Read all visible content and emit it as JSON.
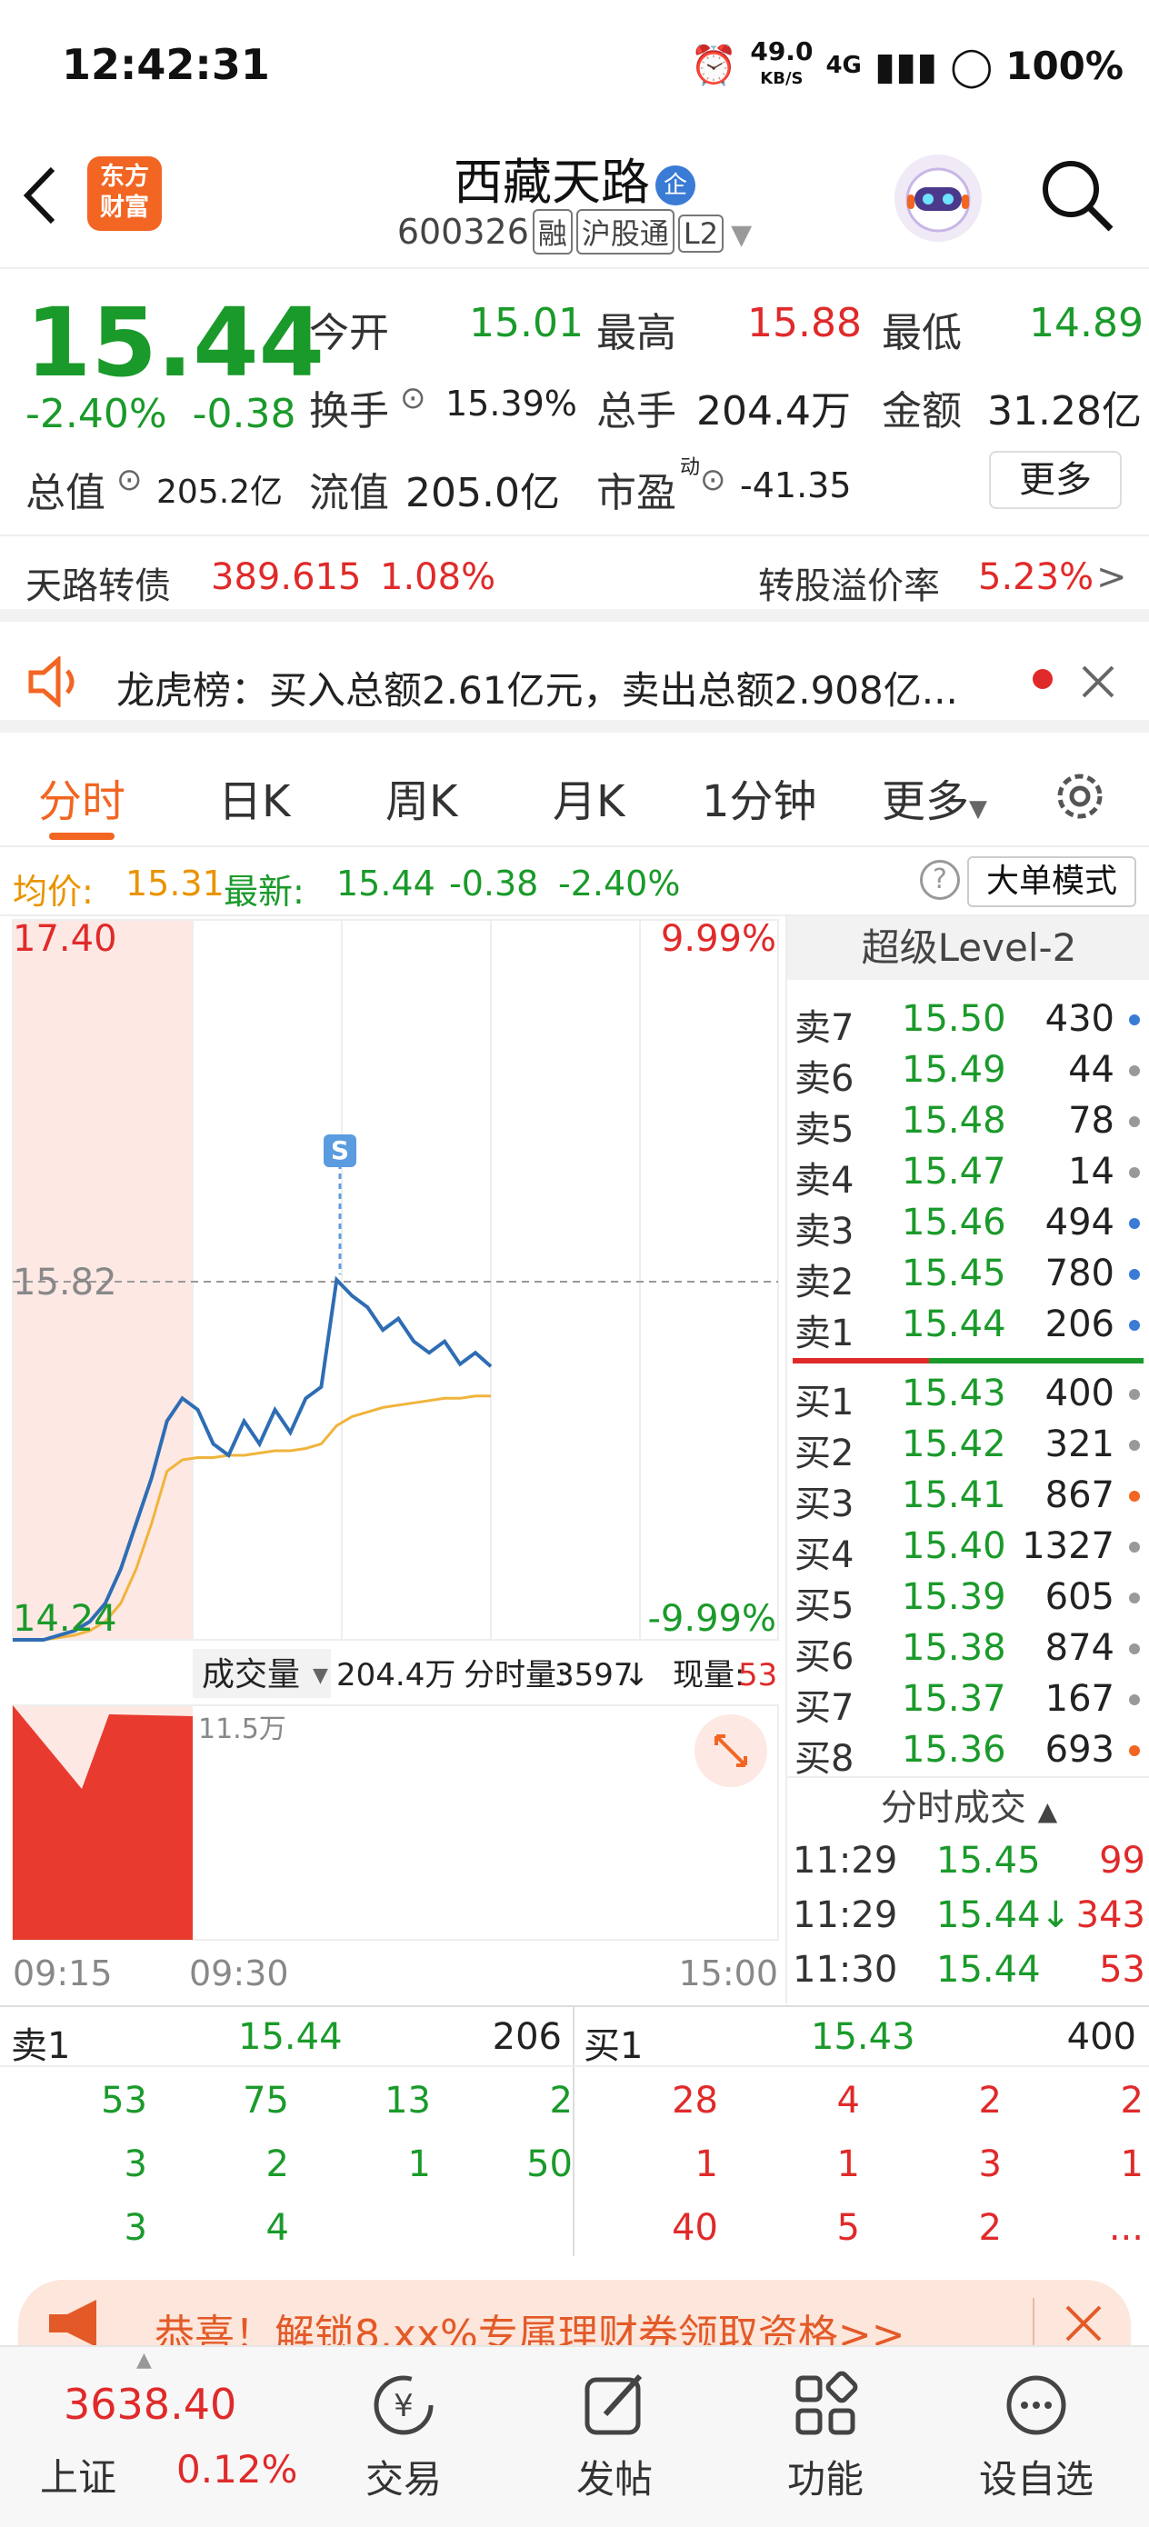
{
  "status_bar": {
    "time": "12:42:31",
    "net_speed": "49.0",
    "net_unit": "KB/S",
    "network": "4G",
    "battery": "100%"
  },
  "header": {
    "stock_name": "西藏天路",
    "badge": "企",
    "code": "600326",
    "tags": [
      "融",
      "沪股通",
      "L2"
    ],
    "logo_line1": "东方",
    "logo_line2": "财富"
  },
  "quote": {
    "price": "15.44",
    "change_pct": "-2.40%",
    "change": "-0.38",
    "open_label": "今开",
    "open": "15.01",
    "high_label": "最高",
    "high": "15.88",
    "low_label": "最低",
    "low": "14.89",
    "turnover_label": "换手",
    "turnover": "15.39%",
    "volume_label": "总手",
    "volume": "204.4万",
    "amount_label": "金额",
    "amount": "31.28亿",
    "mktcap_label": "总值",
    "mktcap": "205.2亿",
    "float_label": "流值",
    "float_cap": "205.0亿",
    "pe_label": "市盈",
    "pe_sup": "动",
    "pe": "-41.35",
    "more_label": "更多"
  },
  "convertible": {
    "name": "天路转债",
    "price": "389.615",
    "pct": "1.08%",
    "premium_label": "转股溢价率",
    "premium": "5.23%"
  },
  "dragon": {
    "text": "龙虎榜：买入总额2.61亿元，卖出总额2.908亿..."
  },
  "tabs": [
    {
      "label": "分时"
    },
    {
      "label": "日K"
    },
    {
      "label": "周K"
    },
    {
      "label": "月K"
    },
    {
      "label": "1分钟"
    },
    {
      "label": "更多"
    }
  ],
  "avg_row": {
    "avg_label": "均价:",
    "avg": "15.31",
    "latest_label": "最新:",
    "latest": "15.44",
    "change": "-0.38",
    "pct": "-2.40%",
    "bigorder_label": "大单模式"
  },
  "chart": {
    "top_price": "17.40",
    "top_pct": "9.99%",
    "mid_price": "15.82",
    "bottom_price": "14.24",
    "bottom_pct": "-9.99%",
    "s_marker": "S",
    "vol_label": "成交量",
    "vol_total": "204.4万",
    "vol_period_label": "分时量:",
    "vol_period": "3597",
    "vol_now_label": "现量:",
    "vol_now": "53",
    "vol_max": "11.5万",
    "t_start": "09:15",
    "t_mid": "09:30",
    "t_end": "15:00"
  },
  "chart_data": {
    "type": "line",
    "title": "",
    "series": [
      {
        "values": [
          14.24,
          14.24,
          14.24,
          14.26,
          14.28,
          14.32,
          14.4,
          14.55,
          14.75,
          14.95,
          15.2,
          15.3,
          15.25,
          15.1,
          15.05,
          15.2,
          15.1,
          15.25,
          15.15,
          15.3,
          15.35,
          15.82,
          15.75,
          15.7,
          15.6,
          15.65,
          15.55,
          15.5,
          15.55,
          15.45,
          15.5,
          15.44
        ]
      },
      {
        "values": [
          14.24,
          14.24,
          14.24,
          14.25,
          14.26,
          14.28,
          14.32,
          14.4,
          14.55,
          14.75,
          14.98,
          15.03,
          15.04,
          15.04,
          15.05,
          15.05,
          15.06,
          15.07,
          15.07,
          15.08,
          15.1,
          15.18,
          15.22,
          15.24,
          15.26,
          15.27,
          15.28,
          15.29,
          15.3,
          15.3,
          15.31,
          15.31
        ]
      }
    ],
    "ylim": [
      14.24,
      17.4
    ]
  },
  "level2": {
    "title": "超级Level-2",
    "asks": [
      {
        "label": "卖7",
        "price": "15.50",
        "vol": "430",
        "dot": "#3a7bd5"
      },
      {
        "label": "卖6",
        "price": "15.49",
        "vol": "44",
        "dot": "#999999"
      },
      {
        "label": "卖5",
        "price": "15.48",
        "vol": "78",
        "dot": "#999999"
      },
      {
        "label": "卖4",
        "price": "15.47",
        "vol": "14",
        "dot": "#999999"
      },
      {
        "label": "卖3",
        "price": "15.46",
        "vol": "494",
        "dot": "#3a7bd5"
      },
      {
        "label": "卖2",
        "price": "15.45",
        "vol": "780",
        "dot": "#3a7bd5"
      },
      {
        "label": "卖1",
        "price": "15.44",
        "vol": "206",
        "dot": "#3a7bd5"
      }
    ],
    "bids": [
      {
        "label": "买1",
        "price": "15.43",
        "vol": "400",
        "dot": "#999999"
      },
      {
        "label": "买2",
        "price": "15.42",
        "vol": "321",
        "dot": "#999999"
      },
      {
        "label": "买3",
        "price": "15.41",
        "vol": "867",
        "dot": "#f26522"
      },
      {
        "label": "买4",
        "price": "15.40",
        "vol": "1327",
        "dot": "#999999"
      },
      {
        "label": "买5",
        "price": "15.39",
        "vol": "605",
        "dot": "#999999"
      },
      {
        "label": "买6",
        "price": "15.38",
        "vol": "874",
        "dot": "#999999"
      },
      {
        "label": "买7",
        "price": "15.37",
        "vol": "167",
        "dot": "#999999"
      },
      {
        "label": "买8",
        "price": "15.36",
        "vol": "693",
        "dot": "#f26522"
      }
    ],
    "trades_title": "分时成交",
    "trades": [
      {
        "time": "11:29",
        "price": "15.45",
        "vol": "99"
      },
      {
        "time": "11:29",
        "price": "15.44↓",
        "vol": "343"
      },
      {
        "time": "11:30",
        "price": "15.44",
        "vol": "53"
      }
    ]
  },
  "queue": {
    "ask": {
      "label": "卖1",
      "price": "15.44",
      "vol": "206",
      "rows": [
        [
          "53",
          "75",
          "13",
          "2"
        ],
        [
          "3",
          "2",
          "1",
          "50"
        ],
        [
          "3",
          "4",
          "",
          ""
        ]
      ]
    },
    "bid": {
      "label": "买1",
      "price": "15.43",
      "vol": "400",
      "rows": [
        [
          "28",
          "4",
          "2",
          "2"
        ],
        [
          "1",
          "1",
          "3",
          "1"
        ],
        [
          "40",
          "5",
          "2",
          "..."
        ]
      ]
    }
  },
  "banner": {
    "text": "恭喜！解锁8.xx%专属理财券领取资格>>"
  },
  "navbar": {
    "index_value": "3638.40",
    "index_name": "上证",
    "index_pct": "0.12%",
    "items": [
      {
        "label": "交易"
      },
      {
        "label": "发帖"
      },
      {
        "label": "功能"
      },
      {
        "label": "设自选"
      }
    ]
  },
  "colors": {
    "up": "#e02a2a",
    "down": "#1a9a2a",
    "accent": "#f26522",
    "price_line": "#2e6db4",
    "avg_line": "#f0b43c"
  }
}
